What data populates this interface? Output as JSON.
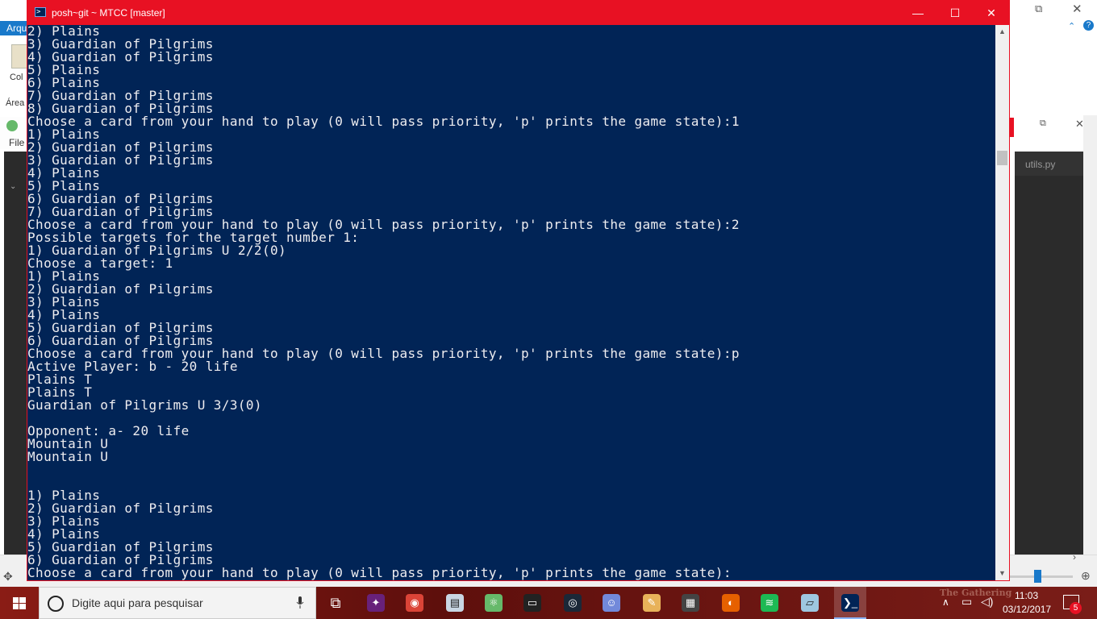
{
  "background": {
    "ribbon_tab": "Arqu",
    "ribbon_paste_label": "Col",
    "ribbon_area_label": "Área",
    "atom_file_menu": "File",
    "editor_tab": "utils.py"
  },
  "powershell": {
    "title": "posh~git ~ MTCC [master]",
    "minimize": "—",
    "maximize": "☐",
    "close": "✕",
    "lines": [
      "2) Plains",
      "3) Guardian of Pilgrims",
      "4) Guardian of Pilgrims",
      "5) Plains",
      "6) Plains",
      "7) Guardian of Pilgrims",
      "8) Guardian of Pilgrims",
      "Choose a card from your hand to play (0 will pass priority, 'p' prints the game state):1",
      "1) Plains",
      "2) Guardian of Pilgrims",
      "3) Guardian of Pilgrims",
      "4) Plains",
      "5) Plains",
      "6) Guardian of Pilgrims",
      "7) Guardian of Pilgrims",
      "Choose a card from your hand to play (0 will pass priority, 'p' prints the game state):2",
      "Possible targets for the target number 1:",
      "1) Guardian of Pilgrims U 2/2(0)",
      "Choose a target: 1",
      "1) Plains",
      "2) Guardian of Pilgrims",
      "3) Plains",
      "4) Plains",
      "5) Guardian of Pilgrims",
      "6) Guardian of Pilgrims",
      "Choose a card from your hand to play (0 will pass priority, 'p' prints the game state):p",
      "Active Player: b - 20 life",
      "Plains T",
      "Plains T",
      "Guardian of Pilgrims U 3/3(0)",
      "",
      "Opponent: a- 20 life",
      "Mountain U",
      "Mountain U",
      "",
      "",
      "1) Plains",
      "2) Guardian of Pilgrims",
      "3) Plains",
      "4) Plains",
      "5) Guardian of Pilgrims",
      "6) Guardian of Pilgrims",
      "Choose a card from your hand to play (0 will pass priority, 'p' prints the game state):"
    ]
  },
  "taskbar": {
    "search_placeholder": "Digite aqui para pesquisar",
    "wallpaper_text": "The Gathering",
    "clock_time": "11:03",
    "clock_date": "03/12/2017",
    "notification_count": "5",
    "pinned_apps": [
      {
        "icon": "task-view-icon",
        "glyph": "⧉",
        "color": "#ffffff"
      },
      {
        "icon": "visual-studio-icon",
        "glyph": "✦",
        "color": "#68217a"
      },
      {
        "icon": "chrome-icon",
        "glyph": "◉",
        "color": "#db4437"
      },
      {
        "icon": "explorer-icon",
        "glyph": "▤",
        "color": "#c9d6e3"
      },
      {
        "icon": "atom-icon",
        "glyph": "⚛",
        "color": "#66b96a"
      },
      {
        "icon": "terminal-icon",
        "glyph": "▭",
        "color": "#222222"
      },
      {
        "icon": "steam-icon",
        "glyph": "◎",
        "color": "#1b2838"
      },
      {
        "icon": "discord-icon",
        "glyph": "☺",
        "color": "#7289da"
      },
      {
        "icon": "paint-icon",
        "glyph": "✎",
        "color": "#e8b25a"
      },
      {
        "icon": "calculator-icon",
        "glyph": "▦",
        "color": "#444444"
      },
      {
        "icon": "firefox-icon",
        "glyph": "◐",
        "color": "#e66000"
      },
      {
        "icon": "spotify-icon",
        "glyph": "≋",
        "color": "#1db954"
      },
      {
        "icon": "notes-icon",
        "glyph": "▱",
        "color": "#9ec7e0"
      },
      {
        "icon": "powershell-icon",
        "glyph": "❯_",
        "color": "#012456"
      }
    ]
  }
}
